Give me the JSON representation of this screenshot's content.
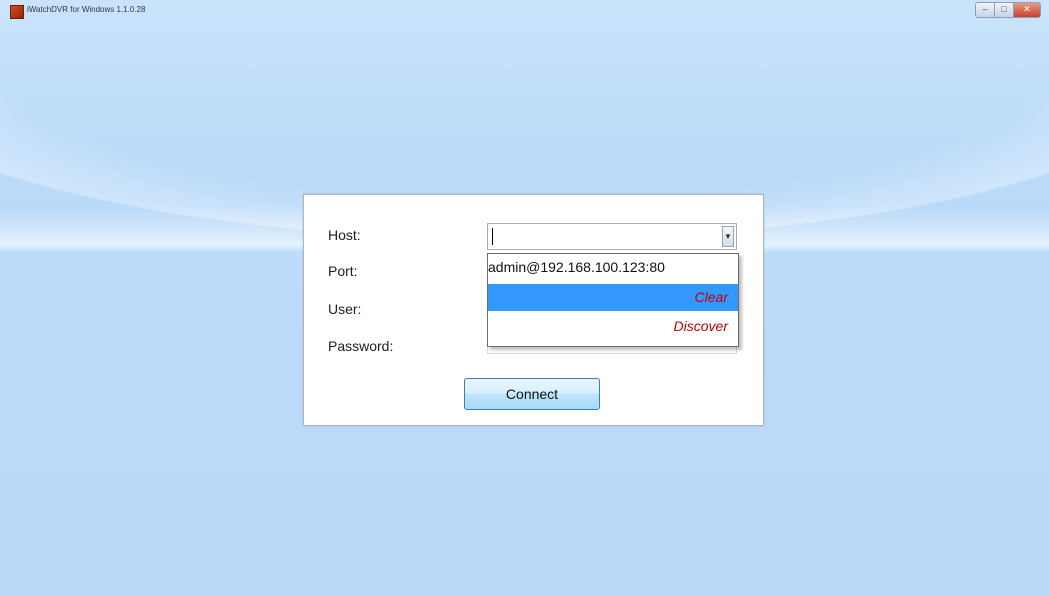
{
  "window": {
    "title": "iWatchDVR for Windows 1.1.0.28",
    "controls": {
      "minimize": "–",
      "maximize": "□",
      "close": "✕"
    }
  },
  "login": {
    "host_label": "Host:",
    "port_label": "Port:",
    "user_label": "User:",
    "password_label": "Password:",
    "host_value": "",
    "connect_label": "Connect"
  },
  "host_dropdown": {
    "items": [
      "admin@192.168.100.123:80",
      "Clear",
      "Discover"
    ],
    "highlighted": "Clear"
  },
  "colors": {
    "background": "#b8d8f7",
    "highlight": "#3399ff",
    "action_text": "#c00000"
  }
}
